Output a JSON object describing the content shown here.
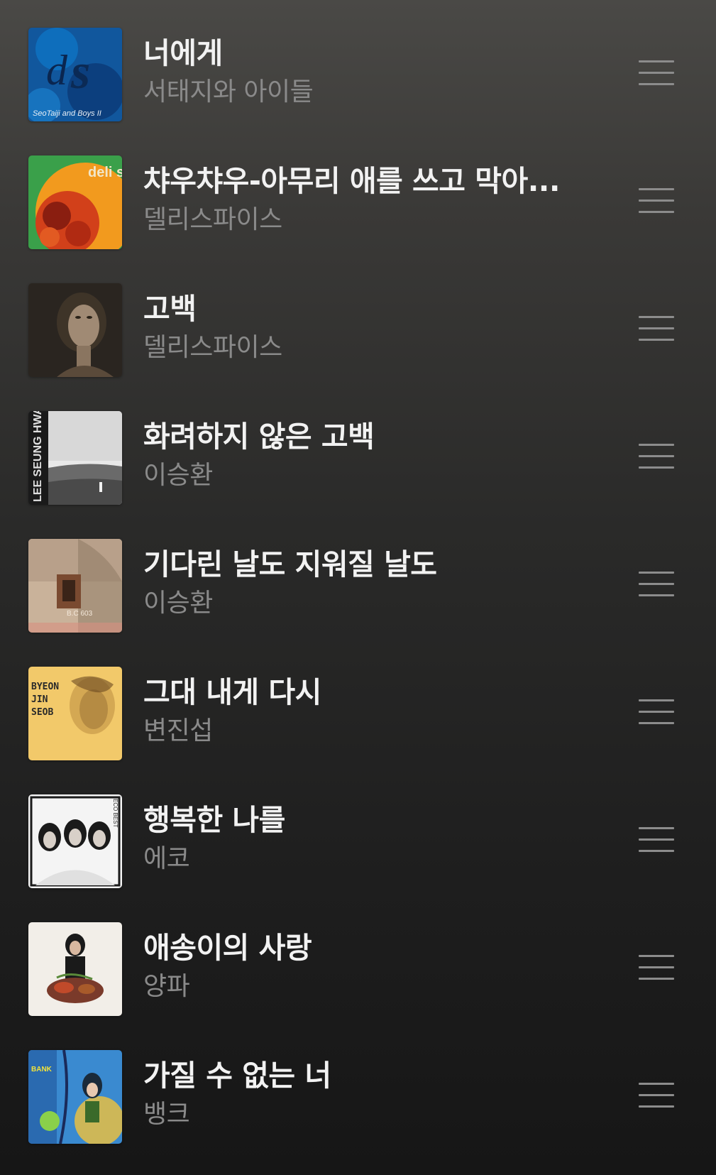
{
  "tracks": [
    {
      "title": "너에게",
      "artist": "서태지와 아이들",
      "cover_text": "SeoTaiji and Boys II"
    },
    {
      "title": "챠우챠우-아무리 애를 쓰고 막아...",
      "artist": "델리스파이스",
      "cover_text": "deli spice"
    },
    {
      "title": "고백",
      "artist": "델리스파이스",
      "cover_text": ""
    },
    {
      "title": "화려하지 않은 고백",
      "artist": "이승환",
      "cover_text": "LEE SEUNG HWAN"
    },
    {
      "title": "기다린 날도 지워질 날도",
      "artist": "이승환",
      "cover_text": "B.C 603"
    },
    {
      "title": "그대 내게 다시",
      "artist": "변진섭",
      "cover_text": "BYEON JIN SEOB"
    },
    {
      "title": "행복한 나를",
      "artist": "에코",
      "cover_text": "ECO BEST"
    },
    {
      "title": "애송이의 사랑",
      "artist": "양파",
      "cover_text": ""
    },
    {
      "title": "가질 수 없는 너",
      "artist": "뱅크",
      "cover_text": "BANK"
    }
  ],
  "icons": {
    "drag_handle": "drag-handle-icon"
  },
  "colors": {
    "title_text": "#f2f2f2",
    "artist_text": "#8a8a8a",
    "drag_handle": "#8c8c8c"
  }
}
